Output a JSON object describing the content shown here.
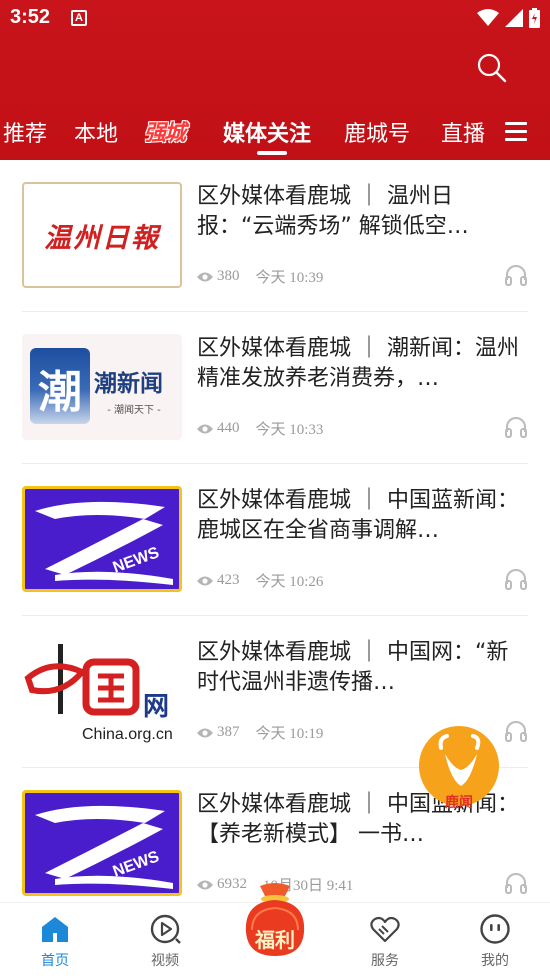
{
  "status_bar": {
    "time": "3:52",
    "notification_letter": "A"
  },
  "tabs": [
    {
      "label": "推荐"
    },
    {
      "label": "本地"
    },
    {
      "label": "强城"
    },
    {
      "label": "媒体关注"
    },
    {
      "label": "鹿城号"
    },
    {
      "label": "直播"
    }
  ],
  "active_tab": "媒体关注",
  "articles": [
    {
      "title": "区外媒体看鹿城 ｜ 温州日报：“云端秀场” 解锁低空…",
      "views": "380",
      "time": "今天  10:39",
      "thumb_text": "温州日報"
    },
    {
      "title": "区外媒体看鹿城 ｜ 潮新闻：温州精准发放养老消费券，…",
      "views": "440",
      "time": "今天  10:33",
      "thumb_text": "潮新闻",
      "thumb_sub": "- 潮闻天下 -",
      "thumb_char": "潮"
    },
    {
      "title": "区外媒体看鹿城 ｜ 中国蓝新闻：鹿城区在全省商事调解…",
      "views": "423",
      "time": "今天  10:26",
      "thumb_text": "NEWS"
    },
    {
      "title": "区外媒体看鹿城 ｜ 中国网：“新时代温州非遗传播…",
      "views": "387",
      "time": "今天  10:19",
      "thumb_text": "网",
      "thumb_sub": "China.org.cn"
    },
    {
      "title": "区外媒体看鹿城 ｜ 中国蓝新闻：【养老新模式】 一书…",
      "views": "6932",
      "time": "10月30日  9:41",
      "thumb_text": "NEWS"
    }
  ],
  "float_badge": {
    "label": "鹿闻"
  },
  "bottom_nav": [
    {
      "label": "首页"
    },
    {
      "label": "视频"
    },
    {
      "label": "福利"
    },
    {
      "label": "服务"
    },
    {
      "label": "我的"
    }
  ],
  "colors": {
    "brand_red": "#c8141a",
    "active_blue": "#1b88d8",
    "text_gray": "#9a9a9a"
  }
}
